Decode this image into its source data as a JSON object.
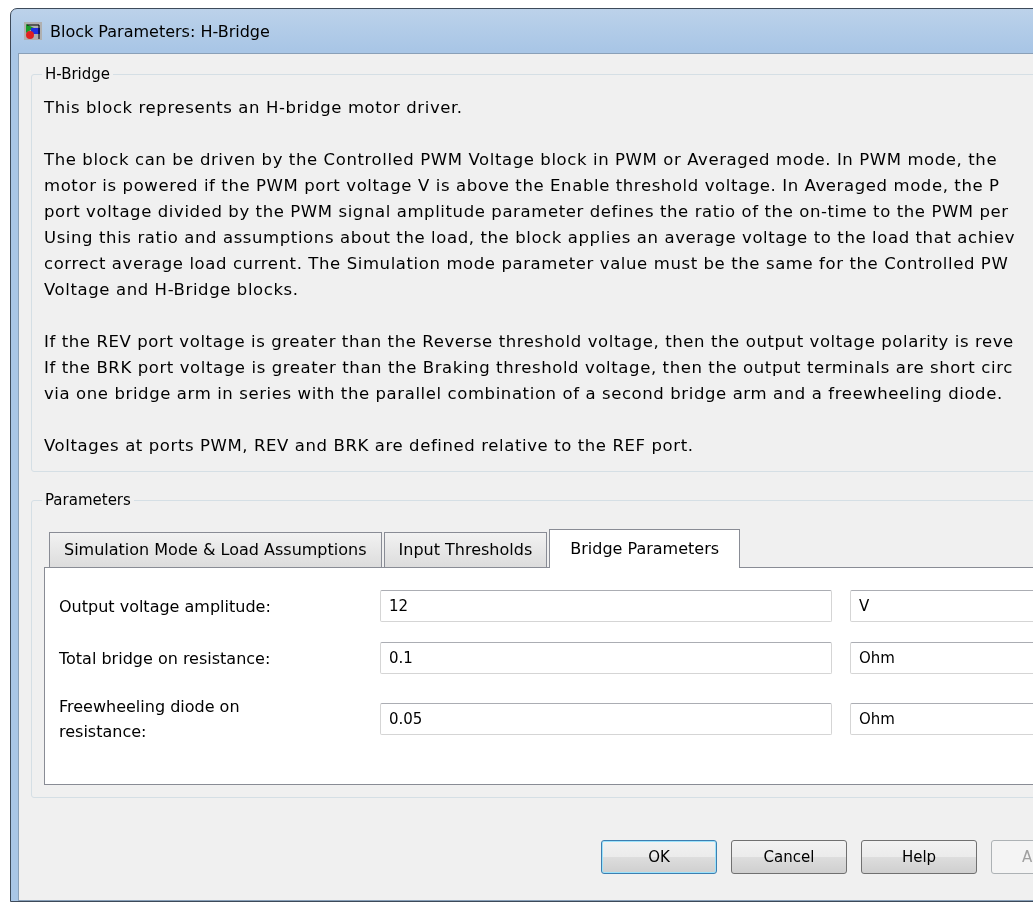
{
  "window": {
    "title": "Block Parameters: H-Bridge"
  },
  "description": {
    "title": "H-Bridge",
    "paragraphs": [
      {
        "lines": [
          "This block represents an H-bridge motor driver."
        ]
      },
      {
        "lines": [
          "The block can be driven by the Controlled PWM Voltage block in PWM or Averaged mode. In PWM mode, the",
          "motor is powered if the PWM port voltage V is above the Enable threshold voltage. In Averaged mode, the P",
          "port voltage divided by the PWM signal amplitude parameter defines the ratio of the on-time to the PWM per",
          "Using this ratio and assumptions about the load, the block applies an average voltage to the load that achiev",
          "correct average load current. The Simulation mode parameter value must be the same for the Controlled PW",
          "Voltage and H-Bridge blocks."
        ]
      },
      {
        "lines": [
          "If the REV port voltage is greater than the Reverse threshold voltage, then the output voltage polarity is reve",
          "If the BRK port voltage is greater than the Braking threshold voltage, then the output terminals are short circ",
          "via one bridge arm in series with the parallel combination of a second bridge arm and a freewheeling diode."
        ]
      },
      {
        "lines": [
          "Voltages at ports PWM, REV and BRK are defined relative to the REF port."
        ]
      }
    ]
  },
  "parameters": {
    "title": "Parameters",
    "tabs": [
      {
        "label": "Simulation Mode & Load Assumptions",
        "selected": false
      },
      {
        "label": "Input Thresholds",
        "selected": false
      },
      {
        "label": "Bridge Parameters",
        "selected": true
      }
    ],
    "rows": [
      {
        "label": "Output voltage amplitude:",
        "value": "12",
        "unit": "V"
      },
      {
        "label": "Total bridge on resistance:",
        "value": "0.1",
        "unit": "Ohm"
      },
      {
        "label": "Freewheeling diode on resistance:",
        "value": "0.05",
        "unit": "Ohm"
      }
    ]
  },
  "buttons": [
    {
      "label": "OK",
      "default": true,
      "disabled": false
    },
    {
      "label": "Cancel",
      "default": false,
      "disabled": false
    },
    {
      "label": "Help",
      "default": false,
      "disabled": false
    },
    {
      "label": "A",
      "default": false,
      "disabled": true
    }
  ]
}
